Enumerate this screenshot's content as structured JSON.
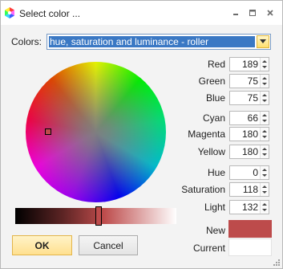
{
  "window": {
    "title": "Select color ..."
  },
  "colors": {
    "label": "Colors:",
    "selected": "hue, saturation and luminance - roller"
  },
  "rgb": [
    {
      "label": "Red",
      "value": "189"
    },
    {
      "label": "Green",
      "value": "75"
    },
    {
      "label": "Blue",
      "value": "75"
    }
  ],
  "cmy": [
    {
      "label": "Cyan",
      "value": "66"
    },
    {
      "label": "Magenta",
      "value": "180"
    },
    {
      "label": "Yellow",
      "value": "180"
    }
  ],
  "hsl": [
    {
      "label": "Hue",
      "value": "0"
    },
    {
      "label": "Saturation",
      "value": "118"
    },
    {
      "label": "Light",
      "value": "132"
    }
  ],
  "preview": {
    "new_label": "New",
    "current_label": "Current",
    "new_color": "#bd4b4b",
    "current_color": "#ffffff"
  },
  "buttons": {
    "ok": "OK",
    "cancel": "Cancel"
  },
  "icons": {
    "app": "color-wheel-icon",
    "minimize": "minimize-icon",
    "maximize": "maximize-icon",
    "close": "close-icon",
    "dropdown": "chevron-down-icon"
  },
  "colors_theme": {
    "selection": "#3a78c4",
    "accent": "#ffdf6e"
  }
}
